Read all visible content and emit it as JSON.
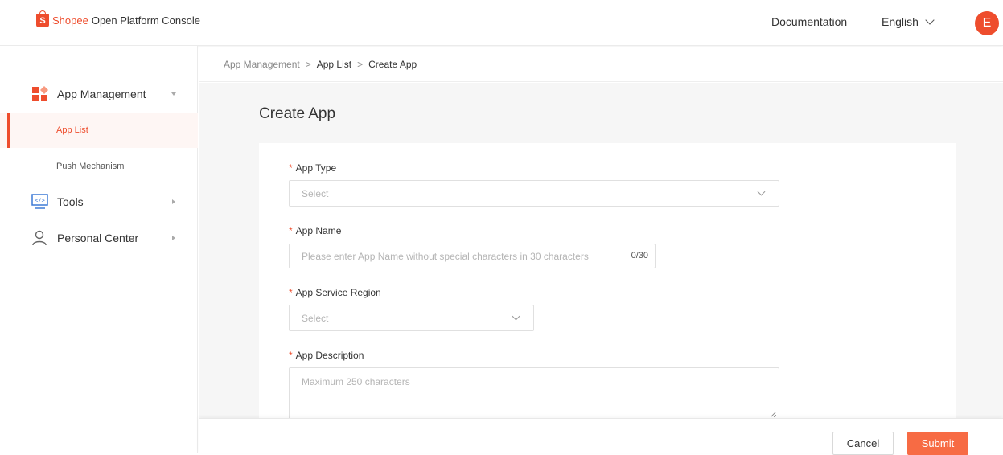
{
  "header": {
    "brand": "Shopee",
    "subtitle": "Open Platform Console",
    "logo_letter": "S",
    "documentation_label": "Documentation",
    "language_label": "English",
    "avatar_letter": "E",
    "brand_color": "#ee4d2d"
  },
  "sidebar": {
    "groups": [
      {
        "label": "App Management",
        "icon": "app-grid-icon",
        "state": "expanded",
        "items": [
          {
            "label": "App List",
            "active": true
          },
          {
            "label": "Push Mechanism",
            "active": false
          }
        ]
      },
      {
        "label": "Tools",
        "icon": "code-monitor-icon",
        "state": "collapsed"
      },
      {
        "label": "Personal Center",
        "icon": "user-icon",
        "state": "collapsed"
      }
    ]
  },
  "breadcrumb": {
    "items": [
      "App Management",
      "App List",
      "Create App"
    ],
    "separator": ">"
  },
  "page": {
    "title": "Create App"
  },
  "form": {
    "app_type": {
      "label": "App Type",
      "required": true,
      "placeholder": "Select"
    },
    "app_name": {
      "label": "App Name",
      "required": true,
      "placeholder": "Please enter App Name without special characters in 30 characters",
      "counter": "0/30"
    },
    "app_service_region": {
      "label": "App Service Region",
      "required": true,
      "placeholder": "Select"
    },
    "app_description": {
      "label": "App Description",
      "required": true,
      "placeholder": "Maximum 250 characters"
    }
  },
  "footer": {
    "cancel_label": "Cancel",
    "submit_label": "Submit",
    "submit_color": "#f76b44"
  },
  "required_mark": "*"
}
